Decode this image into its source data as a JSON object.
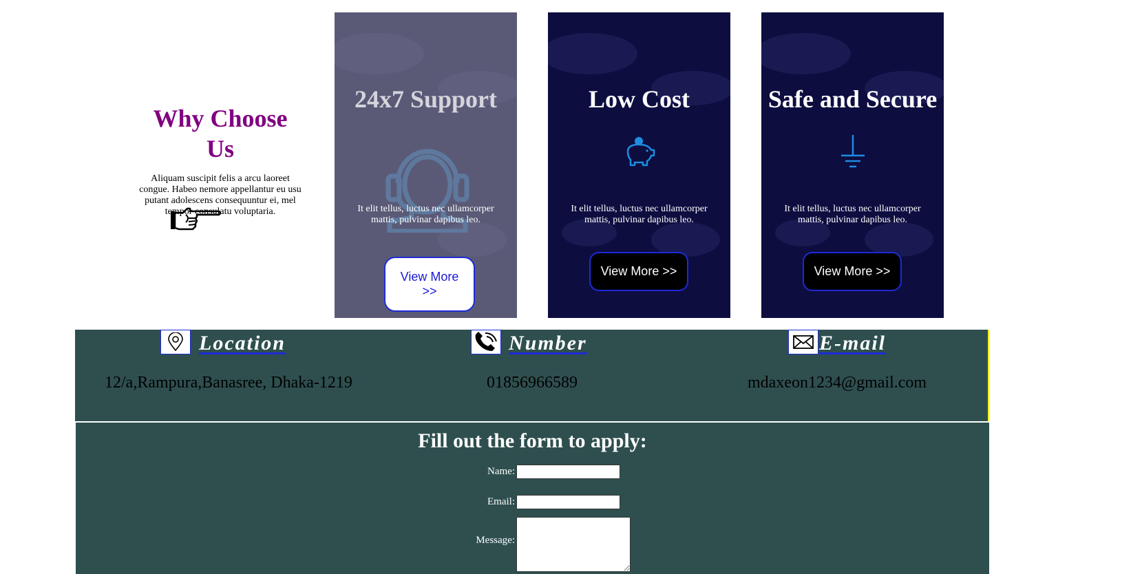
{
  "why": {
    "title": "Why Choose Us",
    "text": "Aliquam suscipit felis a arcu laoreet congue. Habeo nemore appellantur eu usu putant adolescens consequuntur ei, mel tempor consulatu voluptaria.",
    "icon": "pointing-hand-icon"
  },
  "cards": [
    {
      "title": "24x7 Support",
      "icon": "headset-icon",
      "text": "It elit tellus, luctus nec ullamcorper mattis, pulvinar dapibus leo.",
      "button": "View More >>"
    },
    {
      "title": "Low Cost",
      "icon": "piggy-bank-icon",
      "text": "It elit tellus, luctus nec ullamcorper mattis, pulvinar dapibus leo.",
      "button": "View More >>"
    },
    {
      "title": "Safe and Secure",
      "icon": "ground-icon",
      "text": "It elit tellus, luctus nec ullamcorper mattis, pulvinar dapibus leo.",
      "button": "View More >>"
    }
  ],
  "contact": {
    "location": {
      "label": "Location",
      "value": "12/a,Rampura,Banasree, Dhaka-1219",
      "icon": "map-pin-icon"
    },
    "number": {
      "label": "Number",
      "value": "01856966589",
      "icon": "phone-icon"
    },
    "email": {
      "label": "E-mail",
      "value": "mdaxeon1234@gmail.com",
      "icon": "envelope-icon"
    }
  },
  "form": {
    "title": "Fill out the form to apply:",
    "name_label": "Name:",
    "name_value": "",
    "email_label": "Email:",
    "email_value": "",
    "message_label": "Message:",
    "message_value": ""
  },
  "colors": {
    "why_title": "#800080",
    "card_bg": "#0d0d40",
    "band_bg": "#2f4f4f",
    "button_border": "#1d2bd6",
    "icon_blue": "#1e8ce0",
    "band_right_border": "#f5f000"
  }
}
